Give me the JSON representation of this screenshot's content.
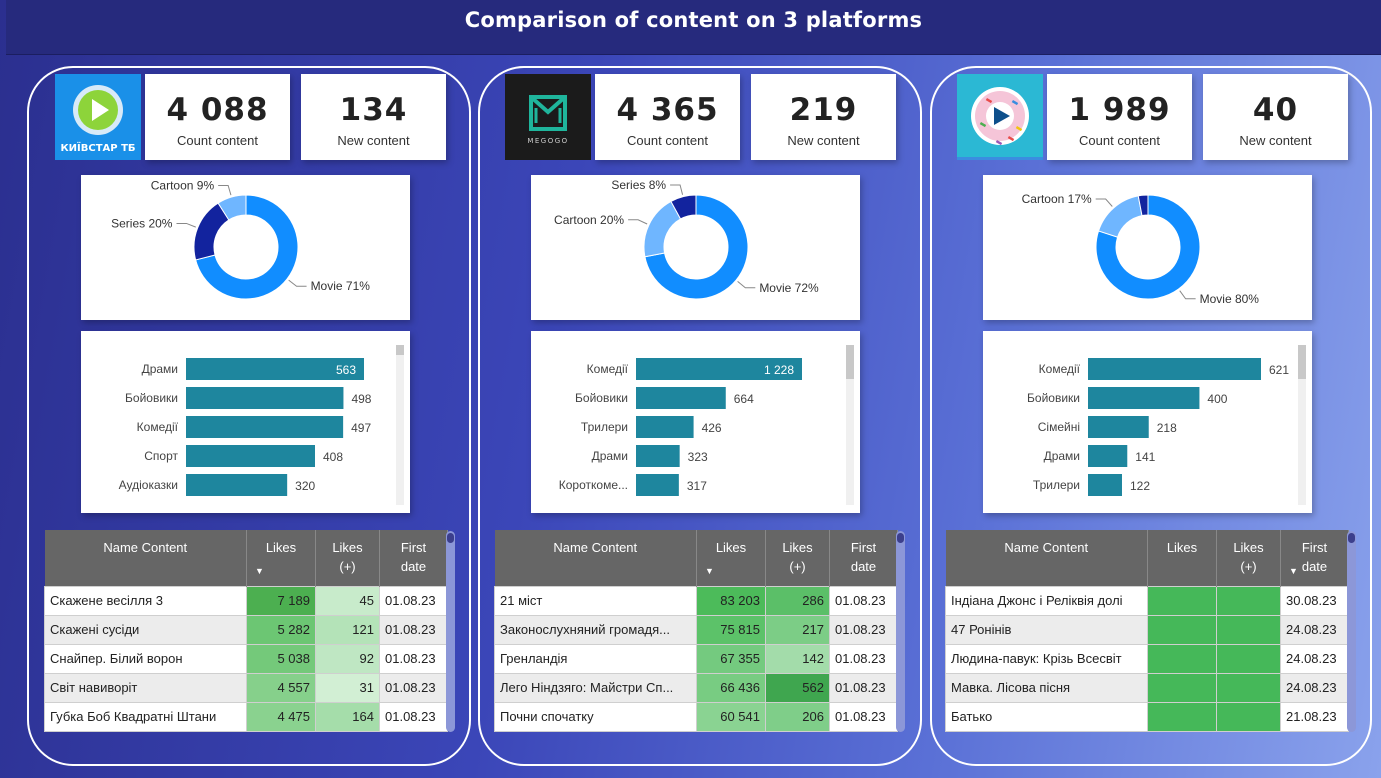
{
  "title": "Comparison of content on 3 platforms",
  "platforms": [
    {
      "logo": {
        "name": "kyivstar-tv-logo",
        "text": "КИЇВСТАР ТБ"
      },
      "count_content": {
        "value": "4 088",
        "label": "Count content"
      },
      "new_content": {
        "value": "134",
        "label": "New content"
      },
      "donut": {
        "type": "pie",
        "slices": [
          {
            "label": "Movie",
            "pct": 71,
            "text": "Movie 71%",
            "color": "#118dff"
          },
          {
            "label": "Series",
            "pct": 20,
            "text": "Series 20%",
            "color": "#12239e"
          },
          {
            "label": "Cartoon",
            "pct": 9,
            "text": "Cartoon 9%",
            "color": "#6fb6ff"
          }
        ]
      },
      "bars": {
        "type": "bar",
        "max": 563,
        "items": [
          {
            "label": "Драми",
            "value": 563,
            "text": "563",
            "inside": true
          },
          {
            "label": "Бойовики",
            "value": 498,
            "text": "498"
          },
          {
            "label": "Комедії",
            "value": 497,
            "text": "497"
          },
          {
            "label": "Спорт",
            "value": 408,
            "text": "408"
          },
          {
            "label": "Аудіоказки",
            "value": 320,
            "text": "320"
          }
        ]
      },
      "table": {
        "headers": [
          "Name Content",
          "Likes",
          "Likes (+)",
          "First date"
        ],
        "sort_column": 1,
        "rows": [
          {
            "name": "Скажене весілля 3",
            "likes": "7 189",
            "likes_plus": "45",
            "date": "01.08.23",
            "lc": "#4caf50",
            "pc": "#c8ebcb"
          },
          {
            "name": "Скажені сусіди",
            "likes": "5 282",
            "likes_plus": "121",
            "date": "01.08.23",
            "lc": "#6cc673",
            "pc": "#b4e3b8"
          },
          {
            "name": "Снайпер. Білий ворон",
            "likes": "5 038",
            "likes_plus": "92",
            "date": "01.08.23",
            "lc": "#74c97a",
            "pc": "#bfe7c3"
          },
          {
            "name": "Світ навиворіт",
            "likes": "4 557",
            "likes_plus": "31",
            "date": "01.08.23",
            "lc": "#86d08b",
            "pc": "#d2efd4"
          },
          {
            "name": "Губка Боб Квадратні Штани",
            "likes": "4 475",
            "likes_plus": "164",
            "date": "01.08.23",
            "lc": "#8ad28f",
            "pc": "#a5ddaa"
          }
        ]
      }
    },
    {
      "logo": {
        "name": "megogo-logo",
        "text": "MEGOGO"
      },
      "count_content": {
        "value": "4 365",
        "label": "Count content"
      },
      "new_content": {
        "value": "219",
        "label": "New content"
      },
      "donut": {
        "type": "pie",
        "slices": [
          {
            "label": "Movie",
            "pct": 72,
            "text": "Movie 72%",
            "color": "#118dff"
          },
          {
            "label": "Cartoon",
            "pct": 20,
            "text": "Cartoon 20%",
            "color": "#6fb6ff"
          },
          {
            "label": "Series",
            "pct": 8,
            "text": "Series 8%",
            "color": "#12239e"
          }
        ]
      },
      "bars": {
        "type": "bar",
        "max": 1228,
        "items": [
          {
            "label": "Комедії",
            "value": 1228,
            "text": "1 228",
            "inside": true
          },
          {
            "label": "Бойовики",
            "value": 664,
            "text": "664"
          },
          {
            "label": "Трилери",
            "value": 426,
            "text": "426"
          },
          {
            "label": "Драми",
            "value": 323,
            "text": "323"
          },
          {
            "label": "Короткоме...",
            "value": 317,
            "text": "317"
          }
        ]
      },
      "table": {
        "headers": [
          "Name Content",
          "Likes",
          "Likes (+)",
          "First date"
        ],
        "sort_column": 1,
        "rows": [
          {
            "name": "21 міст",
            "likes": "83 203",
            "likes_plus": "286",
            "date": "01.08.23",
            "lc": "#4cbb5a",
            "pc": "#5bbf68"
          },
          {
            "name": "Законослухняний громадя...",
            "likes": "75 815",
            "likes_plus": "217",
            "date": "01.08.23",
            "lc": "#5cc269",
            "pc": "#7ccd86"
          },
          {
            "name": "Гренландія",
            "likes": "67 355",
            "likes_plus": "142",
            "date": "01.08.23",
            "lc": "#74ca7f",
            "pc": "#a3dcaa"
          },
          {
            "name": "Лего Ніндзяго: Майстри Сп...",
            "likes": "66 436",
            "likes_plus": "562",
            "date": "01.08.23",
            "lc": "#78cc82",
            "pc": "#3fa64f"
          },
          {
            "name": "Почни спочатку",
            "likes": "60 541",
            "likes_plus": "206",
            "date": "01.08.23",
            "lc": "#8ad392",
            "pc": "#7fce89"
          }
        ]
      }
    },
    {
      "logo": {
        "name": "sweet-tv-logo",
        "text": ""
      },
      "count_content": {
        "value": "1 989",
        "label": "Count content"
      },
      "new_content": {
        "value": "40",
        "label": "New content"
      },
      "donut": {
        "type": "pie",
        "slices": [
          {
            "label": "Movie",
            "pct": 80,
            "text": "Movie 80%",
            "color": "#118dff"
          },
          {
            "label": "Cartoon",
            "pct": 17,
            "text": "Cartoon 17%",
            "color": "#6fb6ff"
          },
          {
            "label": "Series",
            "pct": 3,
            "text": "",
            "color": "#12239e"
          }
        ]
      },
      "bars": {
        "type": "bar",
        "max": 621,
        "items": [
          {
            "label": "Комедії",
            "value": 621,
            "text": "621"
          },
          {
            "label": "Бойовики",
            "value": 400,
            "text": "400"
          },
          {
            "label": "Сімейні",
            "value": 218,
            "text": "218"
          },
          {
            "label": "Драми",
            "value": 141,
            "text": "141"
          },
          {
            "label": "Трилери",
            "value": 122,
            "text": "122"
          }
        ]
      },
      "table": {
        "headers": [
          "Name Content",
          "Likes",
          "Likes (+)",
          "First date"
        ],
        "sort_column": 3,
        "rows": [
          {
            "name": "Індіана Джонс і Реліквія долі",
            "likes": "",
            "likes_plus": "",
            "date": "30.08.23",
            "lc": "#45b859",
            "pc": "#45b859"
          },
          {
            "name": "47 Ронінів",
            "likes": "",
            "likes_plus": "",
            "date": "24.08.23",
            "lc": "#45b859",
            "pc": "#45b859"
          },
          {
            "name": "Людина-павук: Крізь Всесвіт",
            "likes": "",
            "likes_plus": "",
            "date": "24.08.23",
            "lc": "#45b859",
            "pc": "#45b859"
          },
          {
            "name": "Мавка. Лісова пісня",
            "likes": "",
            "likes_plus": "",
            "date": "24.08.23",
            "lc": "#45b859",
            "pc": "#45b859"
          },
          {
            "name": "Батько",
            "likes": "",
            "likes_plus": "",
            "date": "21.08.23",
            "lc": "#45b859",
            "pc": "#45b859"
          }
        ]
      }
    }
  ]
}
